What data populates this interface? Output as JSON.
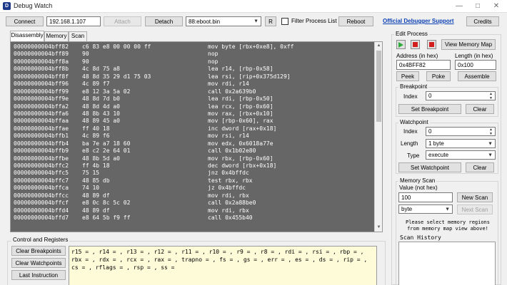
{
  "window": {
    "title": "Debug Watch",
    "min_glyph": "—",
    "max_glyph": "□",
    "close_glyph": "✕"
  },
  "toolbar": {
    "connect_label": "Connect",
    "ip_value": "192.168.1.107",
    "attach_label": "Attach",
    "detach_label": "Detach",
    "process_value": "88:eboot.bin",
    "r_label": "R",
    "filter_label": "Filter Process List",
    "reboot_label": "Reboot",
    "support_link": "Official Debugger Support",
    "credits_label": "Credits"
  },
  "tabs": [
    "Disassembly",
    "Memory",
    "Scan"
  ],
  "disassembly": [
    {
      "addr": "00000000004bff82",
      "bytes": "c6 83 e8 00 00 00 ff",
      "instr": "mov byte [rbx+0xe8], 0xff"
    },
    {
      "addr": "00000000004bff89",
      "bytes": "90",
      "instr": "nop"
    },
    {
      "addr": "00000000004bff8a",
      "bytes": "90",
      "instr": "nop"
    },
    {
      "addr": "00000000004bff8b",
      "bytes": "4c 8d 75 a8",
      "instr": "lea r14, [rbp-0x58]"
    },
    {
      "addr": "00000000004bff8f",
      "bytes": "48 8d 35 29 d1 75 03",
      "instr": "lea rsi, [rip+0x375d129]"
    },
    {
      "addr": "00000000004bff96",
      "bytes": "4c 89 f7",
      "instr": "mov rdi, r14"
    },
    {
      "addr": "00000000004bff99",
      "bytes": "e8 12 3a 5a 02",
      "instr": "call 0x2a639b0"
    },
    {
      "addr": "00000000004bff9e",
      "bytes": "48 8d 7d b0",
      "instr": "lea rdi, [rbp-0x50]"
    },
    {
      "addr": "00000000004bffa2",
      "bytes": "48 8d 4d a0",
      "instr": "lea rcx, [rbp-0x60]"
    },
    {
      "addr": "00000000004bffa6",
      "bytes": "48 8b 43 10",
      "instr": "mov rax, [rbx+0x10]"
    },
    {
      "addr": "00000000004bffaa",
      "bytes": "48 89 45 a0",
      "instr": "mov [rbp-0x60], rax"
    },
    {
      "addr": "00000000004bffae",
      "bytes": "ff 40 18",
      "instr": "inc dword [rax+0x18]"
    },
    {
      "addr": "00000000004bffb1",
      "bytes": "4c 89 f6",
      "instr": "mov rsi, r14"
    },
    {
      "addr": "00000000004bffb4",
      "bytes": "ba 7e a7 18 60",
      "instr": "mov edx, 0x6018a77e"
    },
    {
      "addr": "00000000004bffb9",
      "bytes": "e8 c2 2e 64 01",
      "instr": "call 0x1b02e80"
    },
    {
      "addr": "00000000004bffbe",
      "bytes": "48 8b 5d a0",
      "instr": "mov rbx, [rbp-0x60]"
    },
    {
      "addr": "00000000004bffc2",
      "bytes": "ff 4b 18",
      "instr": "dec dword [rbx+0x18]"
    },
    {
      "addr": "00000000004bffc5",
      "bytes": "75 15",
      "instr": "jnz 0x4bffdc"
    },
    {
      "addr": "00000000004bffc7",
      "bytes": "48 85 db",
      "instr": "test rbx, rbx"
    },
    {
      "addr": "00000000004bffca",
      "bytes": "74 10",
      "instr": "jz 0x4bffdc"
    },
    {
      "addr": "00000000004bffcc",
      "bytes": "48 89 df",
      "instr": "mov rdi, rbx"
    },
    {
      "addr": "00000000004bffcf",
      "bytes": "e8 0c 8c 5c 02",
      "instr": "call 0x2a88be0"
    },
    {
      "addr": "00000000004bffd4",
      "bytes": "48 89 df",
      "instr": "mov rdi, rbx"
    },
    {
      "addr": "00000000004bffd7",
      "bytes": "e8 64 5b f9 ff",
      "instr": "call 0x455b40"
    }
  ],
  "control": {
    "title": "Control and Registers",
    "buttons": [
      "Clear Breakpoints",
      "Clear Watchpoints",
      "Last Instruction"
    ],
    "registers": "r15 = , r14 = , r13 = , r12 = , r11 = , r10 = , r9 = , r8 = , rdi = , rsi = , rbp = , rbx = , rdx = , rcx = , rax = , trapno = , fs = , gs = , err = , es = , ds = , rip = , cs = , rflags = , rsp = , ss ="
  },
  "edit_process": {
    "title": "Edit Process",
    "view_map_label": "View Memory Map",
    "address_label": "Address (in hex)",
    "length_label": "Length (in hex)",
    "address_value": "0x4BFF82",
    "length_value": "0x100",
    "peek_label": "Peek",
    "poke_label": "Poke",
    "assemble_label": "Assemble"
  },
  "breakpoint": {
    "title": "Breakpoint",
    "index_label": "Index",
    "index_value": "0",
    "set_label": "Set Breakpoint",
    "clear_label": "Clear"
  },
  "watchpoint": {
    "title": "Watchpoint",
    "index_label": "Index",
    "index_value": "0",
    "length_label": "Length",
    "length_value": "1 byte",
    "type_label": "Type",
    "type_value": "execute",
    "set_label": "Set Watchpoint",
    "clear_label": "Clear"
  },
  "memory_scan": {
    "title": "Memory Scan",
    "value_label": "Value (not hex)",
    "value": "100",
    "new_scan_label": "New Scan",
    "type_value": "byte",
    "next_scan_label": "Next Scan",
    "message": "Please select memory regions from memory map view above!",
    "history_label": "Scan History"
  },
  "colors": {
    "disasm_bg": "#666666",
    "registers_bg": "#fefbd8",
    "run_green": "#2eaa3a",
    "stop_red": "#d21e1e",
    "link_blue": "#0b3fb3"
  }
}
